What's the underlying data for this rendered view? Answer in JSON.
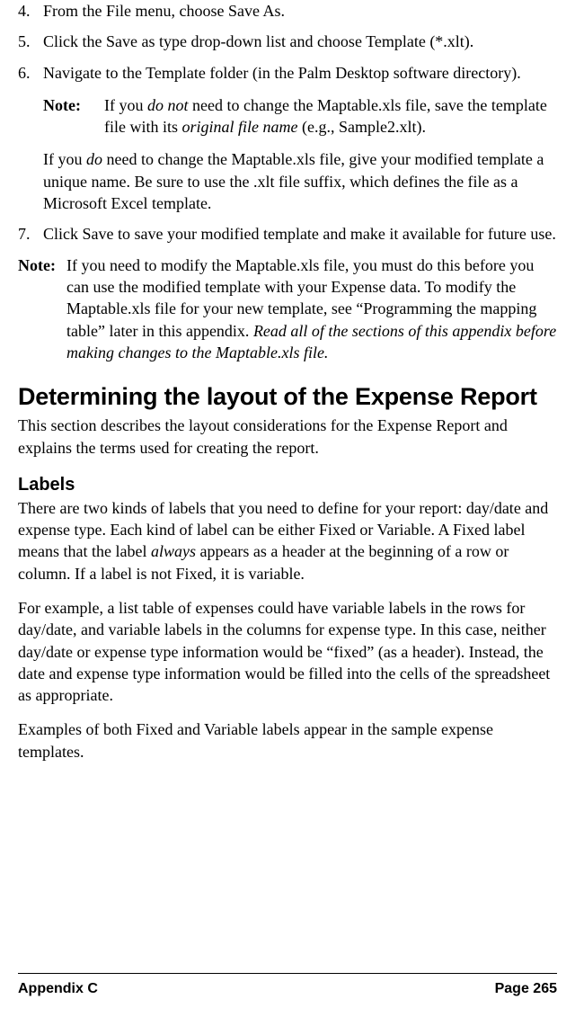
{
  "steps": {
    "s4": {
      "num": "4.",
      "text_a": "From the File menu, choose Save As."
    },
    "s5": {
      "num": "5.",
      "text_a": "Click the Save as type drop-down list and choose Template (*.xlt)."
    },
    "s6": {
      "num": "6.",
      "text_a": "Navigate to the Template folder (in the Palm Desktop software directory)."
    },
    "s7": {
      "num": "7.",
      "text_a": "Click Save to save your modified template and make it available for future use."
    }
  },
  "inner_note": {
    "label": "Note:",
    "pre": "If you ",
    "em1": "do not",
    "mid": " need to change the Maptable.xls file, save the template file with its ",
    "em2": "original file name",
    "post": " (e.g., Sample2.xlt)."
  },
  "after_note": {
    "pre": "If you ",
    "em": "do",
    "post": " need to change the Maptable.xls file, give your modified template a unique name. Be sure to use the .xlt file suffix, which defines the file as a Microsoft Excel template."
  },
  "outer_note": {
    "label": "Note:",
    "part1": "If you need to modify the Maptable.xls file, you must do this before you can use the modified template with your Expense data. To modify the Maptable.xls file for your new template, see “Programming the mapping table”  later in this appendix. ",
    "em": "Read all of the sections of this appendix before making changes to the Maptable.xls file.",
    "part2": ""
  },
  "heading1": "Determining the layout of the Expense Report",
  "intro": "This section describes the layout considerations for the Expense Report and explains the terms used for creating the report.",
  "heading2": "Labels",
  "labels_p1": {
    "pre": "There are two kinds of labels that you need to define for your report: day/date and expense type. Each kind of label can be either Fixed or Variable. A Fixed label means that the label ",
    "em": "always",
    "post": " appears as a header at the beginning of a row or column. If a label is not Fixed, it is variable."
  },
  "labels_p2": "For example, a list table of expenses could have variable labels in the rows for day/date, and variable labels in the columns for expense type. In this case, neither day/date or expense type information would be “fixed” (as a header). Instead, the date and expense type information would be filled into the cells of the spreadsheet as appropriate.",
  "labels_p3": "Examples of both Fixed and Variable labels appear in the sample expense templates.",
  "footer": {
    "left": "Appendix C",
    "right": "Page 265"
  }
}
